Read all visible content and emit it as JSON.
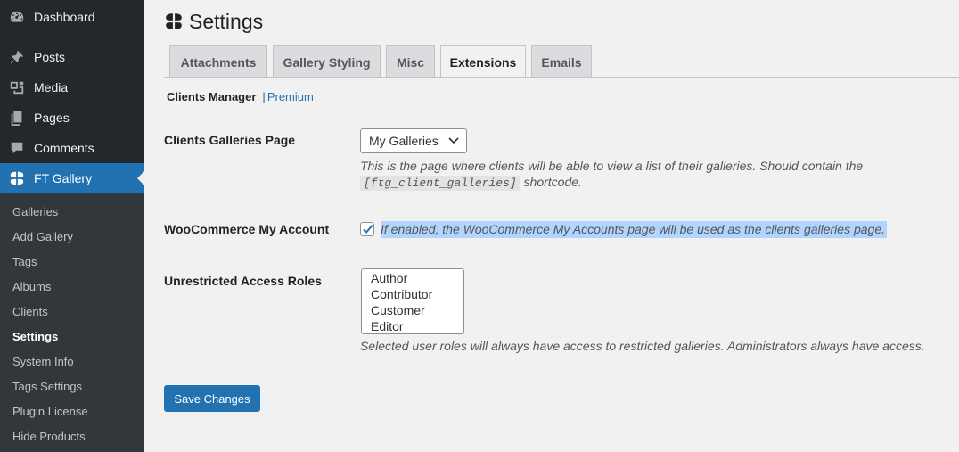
{
  "sidebar": {
    "menu": [
      {
        "label": "Dashboard",
        "icon": "dashboard-icon"
      },
      {
        "label": "Posts",
        "icon": "pin-icon"
      },
      {
        "label": "Media",
        "icon": "media-icon"
      },
      {
        "label": "Pages",
        "icon": "pages-icon"
      },
      {
        "label": "Comments",
        "icon": "comment-icon"
      },
      {
        "label": "FT Gallery",
        "icon": "clover-icon"
      }
    ],
    "submenu": [
      "Galleries",
      "Add Gallery",
      "Tags",
      "Albums",
      "Clients",
      "Settings",
      "System Info",
      "Tags Settings",
      "Plugin License",
      "Hide Products"
    ],
    "current_submenu": "Settings"
  },
  "page": {
    "title": "Settings"
  },
  "tabs": [
    "Attachments",
    "Gallery Styling",
    "Misc",
    "Extensions",
    "Emails"
  ],
  "active_tab": "Extensions",
  "subnav": {
    "current": "Clients Manager",
    "separator": "|",
    "link": "Premium"
  },
  "form": {
    "clients_page": {
      "label": "Clients Galleries Page",
      "selected": "My Galleries",
      "desc_before": "This is the page where clients will be able to view a list of their galleries. Should contain the",
      "shortcode": "[ftg_client_galleries]",
      "desc_after": "shortcode."
    },
    "woocommerce": {
      "label": "WooCommerce My Account",
      "checked": true,
      "desc": "If enabled, the WooCommerce My Accounts page will be used as the clients galleries page."
    },
    "roles": {
      "label": "Unrestricted Access Roles",
      "options": [
        "Author",
        "Contributor",
        "Customer",
        "Editor"
      ],
      "desc": "Selected user roles will always have access to restricted galleries. Administrators always have access."
    }
  },
  "buttons": {
    "save": "Save Changes"
  },
  "colors": {
    "sidebar_bg": "#23282d",
    "submenu_bg": "#32373c",
    "accent": "#2271b1",
    "selection": "#b3d4fc"
  }
}
